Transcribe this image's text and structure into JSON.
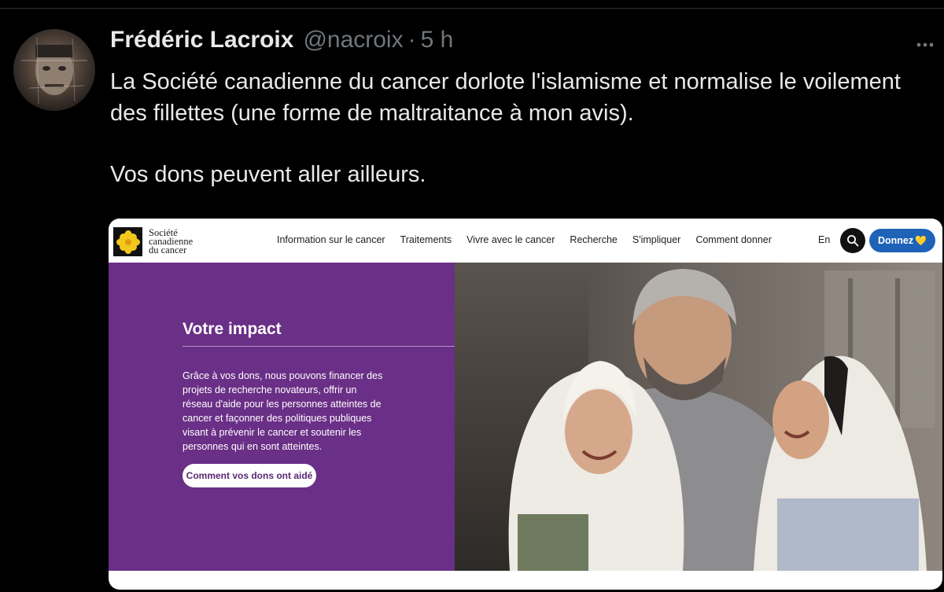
{
  "tweet": {
    "author_name": "Frédéric Lacroix",
    "author_handle": "@nacroix",
    "separator": "·",
    "time": "5 h",
    "paragraph_1": "La Société canadienne du cancer dorlote l'islamisme et normalise le voilement des fillettes (une forme de maltraitance à mon avis).",
    "paragraph_2": "Vos dons peuvent aller ailleurs.",
    "more_icon": "more-horizontal-icon"
  },
  "website": {
    "logo_line_1": "Société",
    "logo_line_2": "canadienne",
    "logo_line_3": "du cancer",
    "logo_icon": "daffodil-icon",
    "nav": [
      "Information sur le cancer",
      "Traitements",
      "Vivre avec le cancer",
      "Recherche",
      "S'impliquer",
      "Comment donner"
    ],
    "language": "En",
    "search_icon": "search-icon",
    "donate_label": "Donnez",
    "donate_heart": "💛",
    "hero": {
      "title": "Votre impact",
      "body": "Grâce à vos dons, nous pouvons financer des projets de recherche novateurs, offrir un réseau d'aide pour les personnes atteintes de cancer et façonner des politiques publiques visant à prévenir le cancer et soutenir les personnes qui en sont atteintes.",
      "button": "Comment vos dons ont aidé"
    },
    "colors": {
      "purple": "#6a2f86",
      "donate_blue": "#1e63b8",
      "daffodil_yellow": "#f2c81c"
    }
  }
}
